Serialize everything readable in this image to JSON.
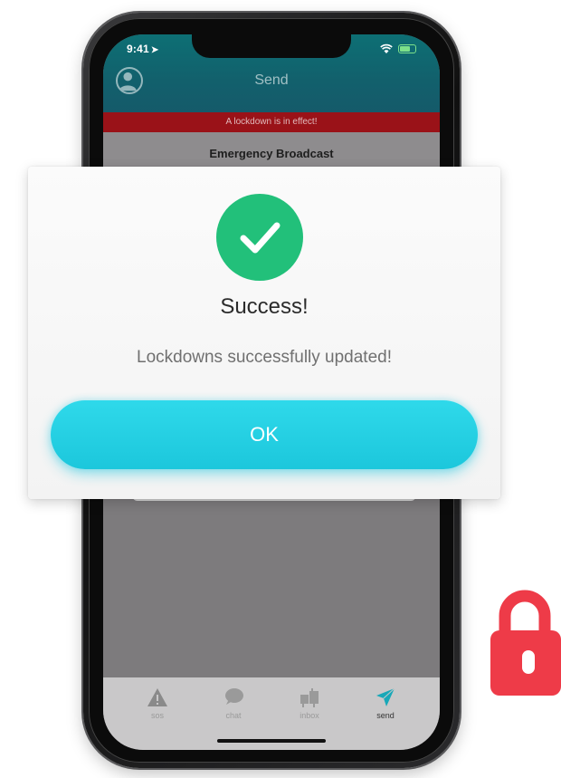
{
  "status_bar": {
    "time": "9:41"
  },
  "header": {
    "title": "Send"
  },
  "banner": {
    "text": "A lockdown is in effect!"
  },
  "screen": {
    "section_title": "Emergency Broadcast"
  },
  "dialog": {
    "title": "Success!",
    "message": "Lockdowns successfully updated!",
    "ok_label": "OK"
  },
  "tabs": [
    {
      "label": "sos",
      "icon": "warning-icon"
    },
    {
      "label": "chat",
      "icon": "chat-bubble-icon"
    },
    {
      "label": "inbox",
      "icon": "mailbox-icon"
    },
    {
      "label": "send",
      "icon": "paper-plane-icon"
    }
  ],
  "colors": {
    "header": "#0d6f74",
    "banner": "#9a1218",
    "success": "#22c07a",
    "button": "#1cc7dc",
    "lock": "#ee3b48"
  }
}
